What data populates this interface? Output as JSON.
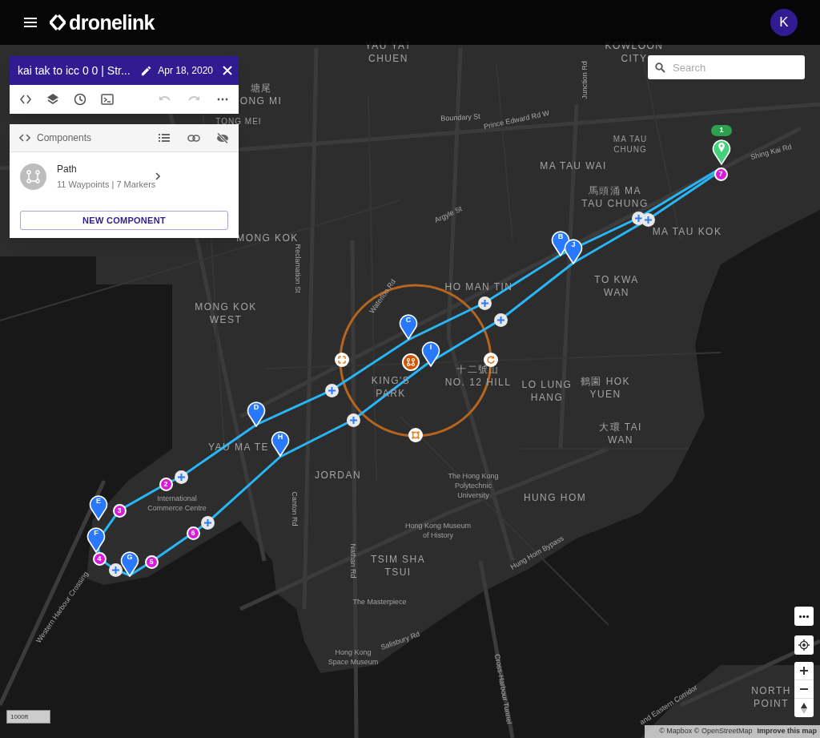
{
  "header": {
    "logo": "dronelink",
    "avatar": "K"
  },
  "plan_panel": {
    "title": "kai tak to icc 0 0 | Str...",
    "date": "Apr 18, 2020",
    "toolbar": [
      {
        "kind": "source",
        "disabled": false
      },
      {
        "kind": "layers",
        "disabled": false
      },
      {
        "kind": "history",
        "disabled": false
      },
      {
        "kind": "terminal",
        "disabled": false
      },
      {
        "kind": "undo",
        "disabled": true
      },
      {
        "kind": "redo",
        "disabled": true
      },
      {
        "kind": "more",
        "disabled": false
      }
    ]
  },
  "components_panel": {
    "title": "Components",
    "items": [
      {
        "name": "Path",
        "details": "11 Waypoints | 7 Markers"
      }
    ],
    "button": "NEW COMPONENT"
  },
  "search": {
    "placeholder": "Search"
  },
  "map": {
    "labels": [
      {
        "kind": "area",
        "text": "YAU YAT\nCHUEN"
      },
      {
        "kind": "area",
        "text": "KOWLOON\nCITY"
      },
      {
        "kind": "area",
        "text": "塘尾\nONG MI"
      },
      {
        "kind": "area_small",
        "text": "TONG MEI"
      },
      {
        "kind": "street",
        "text": "Boundary St"
      },
      {
        "kind": "street",
        "text": "Prince Edward Rd W"
      },
      {
        "kind": "street",
        "text": "Junction Rd"
      },
      {
        "kind": "area_small",
        "text": "MA TAU\nCHUNG"
      },
      {
        "kind": "area",
        "text": "MA TAU WAI"
      },
      {
        "kind": "area",
        "text": "馬頭涌 MA\nTAU CHUNG"
      },
      {
        "kind": "street",
        "text": "Shing Kai Rd"
      },
      {
        "kind": "street",
        "text": "Argyle St"
      },
      {
        "kind": "area",
        "text": "MA TAU KOK"
      },
      {
        "kind": "area",
        "text": "MONG KOK"
      },
      {
        "kind": "area",
        "text": "MONG KOK\nWEST"
      },
      {
        "kind": "street",
        "text": "Reclamation St"
      },
      {
        "kind": "street",
        "text": "Waterloo Rd"
      },
      {
        "kind": "area",
        "text": "HO MAN TIN"
      },
      {
        "kind": "area",
        "text": "TO KWA\nWAN"
      },
      {
        "kind": "area",
        "text": "KING'S\nPARK"
      },
      {
        "kind": "area",
        "text": "十二號山\nNO. 12 HILL"
      },
      {
        "kind": "area",
        "text": "LO LUNG\nHANG"
      },
      {
        "kind": "area",
        "text": "鶴園 HOK\nYUEN"
      },
      {
        "kind": "area",
        "text": "大環 TAI\nWAN"
      },
      {
        "kind": "area",
        "text": "YAU MA TE"
      },
      {
        "kind": "area",
        "text": "JORDAN"
      },
      {
        "kind": "street",
        "text": "Canton Rd"
      },
      {
        "kind": "poi",
        "text": "International\nCommerce Centre"
      },
      {
        "kind": "poi",
        "text": "The Hong Kong\nPolytechnic\nUniversity"
      },
      {
        "kind": "area",
        "text": "HUNG HOM"
      },
      {
        "kind": "poi",
        "text": "Hong Kong Museum\nof History"
      },
      {
        "kind": "street",
        "text": "Nathan Rd"
      },
      {
        "kind": "area",
        "text": "TSIM SHA\nTSUI"
      },
      {
        "kind": "street",
        "text": "Hung Hom Bypass"
      },
      {
        "kind": "street",
        "text": "Western Harbour Crossing"
      },
      {
        "kind": "poi",
        "text": "The Masterpiece"
      },
      {
        "kind": "street",
        "text": "Salisbury Rd"
      },
      {
        "kind": "poi",
        "text": "Hong Kong\nSpace Museum"
      },
      {
        "kind": "street",
        "text": "Cross-Harbour Tunnel"
      },
      {
        "kind": "street",
        "text": "and Eastern Corridor"
      },
      {
        "kind": "area",
        "text": "NORTH\nPOINT"
      }
    ],
    "markers": [
      {
        "label": "B"
      },
      {
        "label": "C"
      },
      {
        "label": "D"
      },
      {
        "label": "E"
      },
      {
        "label": "F"
      },
      {
        "label": "G"
      },
      {
        "label": "H"
      },
      {
        "label": "I"
      },
      {
        "label": "J"
      }
    ],
    "waypoints": [
      {
        "label": "2"
      },
      {
        "label": "3"
      },
      {
        "label": "4"
      },
      {
        "label": "5"
      },
      {
        "label": "6"
      },
      {
        "label": "7"
      }
    ],
    "start_badge": "1",
    "scale": "1000ft",
    "attribution": "© Mapbox © OpenStreetMap",
    "improve_link": "Improve this map"
  }
}
